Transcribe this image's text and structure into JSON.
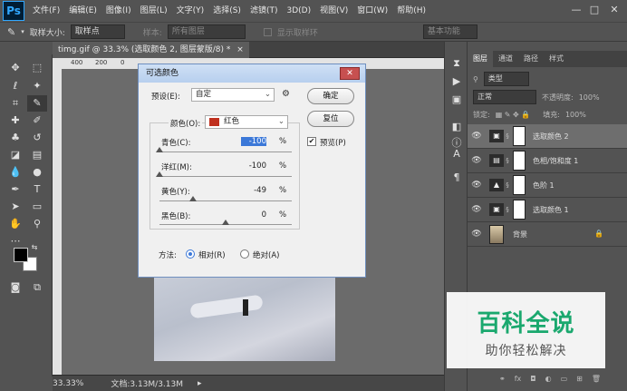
{
  "app": {
    "logo": "Ps"
  },
  "menu": [
    "文件(F)",
    "编辑(E)",
    "图像(I)",
    "图层(L)",
    "文字(Y)",
    "选择(S)",
    "滤镜(T)",
    "3D(D)",
    "视图(V)",
    "窗口(W)",
    "帮助(H)"
  ],
  "window_controls": {
    "minimize": "—",
    "maximize": "□",
    "close": "✕"
  },
  "options": {
    "sample_size_label": "取样大小:",
    "sample_size_value": "取样点",
    "sample_label": "样本:",
    "sample_value": "所有图层",
    "show_ring": "显示取样环",
    "workspace": "基本功能"
  },
  "document": {
    "tab_title": "timg.gif @ 33.3% (选取颜色 2, 图层蒙版/8) *",
    "tab_close": "×",
    "ruler_ticks": [
      "400",
      "200",
      "0",
      "200",
      "400"
    ],
    "zoom": "33.33%",
    "doc_size": "文档:3.13M/3.13M"
  },
  "panel": {
    "tabs": [
      "图层",
      "通道",
      "路径",
      "样式"
    ],
    "filter_kind": "类型",
    "blend_mode": "正常",
    "opacity_label": "不透明度:",
    "opacity_value": "100%",
    "lock_label": "锁定:",
    "fill_label": "填充:",
    "fill_value": "100%",
    "layers": [
      {
        "name": "选取颜色 2",
        "selected": true,
        "icon": "selective-color-icon"
      },
      {
        "name": "色相/饱和度 1",
        "selected": false,
        "icon": "hue-saturation-icon"
      },
      {
        "name": "色阶 1",
        "selected": false,
        "icon": "levels-icon"
      },
      {
        "name": "选取颜色 1",
        "selected": false,
        "icon": "selective-color-icon"
      },
      {
        "name": "背景",
        "selected": false,
        "icon": "background-thumb"
      }
    ],
    "bottom_fx": "fx"
  },
  "dialog": {
    "title": "可选颜色",
    "preset_label": "预设(E):",
    "preset_value": "自定",
    "ok": "确定",
    "reset": "复位",
    "preview": "预览(P)",
    "colors_label": "颜色(O):",
    "colors_value": "红色",
    "swatch_color": "#c0301e",
    "sliders": [
      {
        "label": "青色(C):",
        "value": "-100",
        "level": 0
      },
      {
        "label": "洋红(M):",
        "value": "-100",
        "level": 0
      },
      {
        "label": "黄色(Y):",
        "value": "-49",
        "level": 0.255
      },
      {
        "label": "黑色(B):",
        "value": "0",
        "level": 0.5
      }
    ],
    "percent": "%",
    "method_label": "方法:",
    "method_relative": "相对(R)",
    "method_absolute": "绝对(A)",
    "method_selected": "relative"
  },
  "watermark": {
    "title": "百科全说",
    "subtitle": "助你轻松解决"
  }
}
